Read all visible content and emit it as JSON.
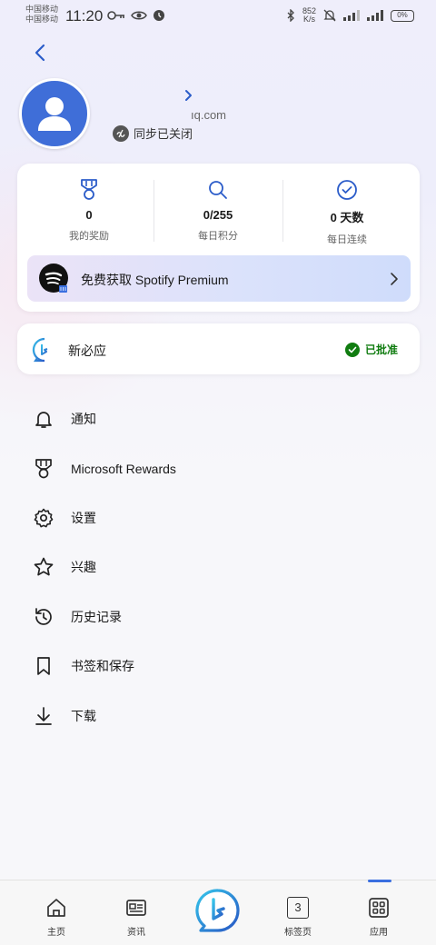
{
  "status_bar": {
    "carrier_1": "中国移动",
    "carrier_2": "中国移动",
    "time": "11:20",
    "net_speed": "852",
    "net_unit": "K/s",
    "battery": "0%"
  },
  "profile": {
    "email_suffix": "ıq.com",
    "sync_status": "同步已关闭"
  },
  "stats": [
    {
      "value": "0",
      "label": "我的奖励",
      "icon": "medal-icon"
    },
    {
      "value": "0/255",
      "label": "每日积分",
      "icon": "search-icon"
    },
    {
      "value": "0 天数",
      "label": "每日连续",
      "icon": "check-circle-icon"
    }
  ],
  "promo": {
    "text": "免费获取 Spotify Premium"
  },
  "bing_card": {
    "title": "新必应",
    "status": "已批准"
  },
  "menu": [
    {
      "label": "通知",
      "icon": "bell-icon"
    },
    {
      "label": "Microsoft Rewards",
      "icon": "medal-icon"
    },
    {
      "label": "设置",
      "icon": "gear-icon"
    },
    {
      "label": "兴趣",
      "icon": "star-icon"
    },
    {
      "label": "历史记录",
      "icon": "history-icon"
    },
    {
      "label": "书签和保存",
      "icon": "bookmark-icon"
    },
    {
      "label": "下载",
      "icon": "download-icon"
    }
  ],
  "bottom_nav": {
    "home": "主页",
    "news": "资讯",
    "tabs": "标签页",
    "tab_count": "3",
    "apps": "应用"
  },
  "colors": {
    "accent": "#3a6fe0",
    "approved_green": "#107c10",
    "avatar_blue": "#3f6ed8"
  }
}
